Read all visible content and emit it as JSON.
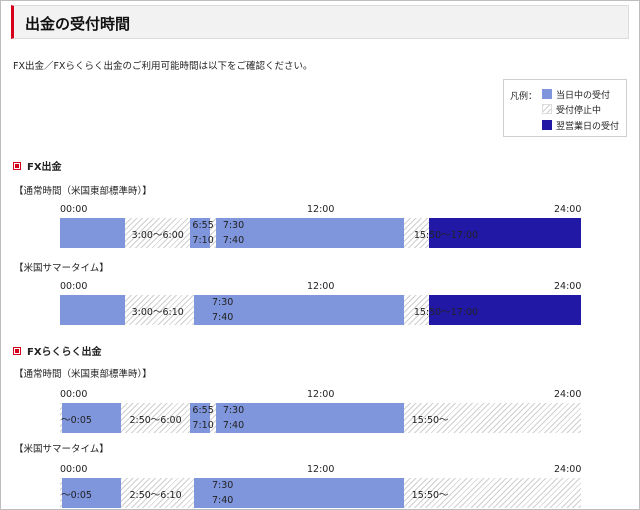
{
  "header": {
    "title": "出金の受付時間"
  },
  "intro": "FX出金／FXらくらく出金のご利用可能時間は以下をご確認ください。",
  "legend": {
    "title": "凡例：",
    "items": [
      {
        "label": "当日中の受付",
        "color": "#7f95dc",
        "kind": "accept"
      },
      {
        "label": "受付停止中",
        "color": "#cfcfcf",
        "kind": "stop"
      },
      {
        "label": "翌営業日の受付",
        "color": "#2218a6",
        "kind": "next"
      }
    ]
  },
  "axis": {
    "start": "00:00",
    "mid": "12:00",
    "end": "24:00"
  },
  "sections": [
    {
      "title": "FX出金",
      "timelines": [
        {
          "label": "【通常時間（米国東部標準時）】",
          "segments": [
            {
              "kind": "accept",
              "start": 0,
              "end": 3
            },
            {
              "kind": "stop",
              "start": 3,
              "end": 6
            },
            {
              "kind": "accept",
              "start": 6,
              "end": 6.917
            },
            {
              "kind": "stop",
              "start": 6.917,
              "end": 7.167
            },
            {
              "kind": "accept",
              "start": 7.167,
              "end": 7.5
            },
            {
              "kind": "accept",
              "start": 7.5,
              "end": 15.833
            },
            {
              "kind": "stop",
              "start": 15.833,
              "end": 17
            },
            {
              "kind": "next",
              "start": 17,
              "end": 24
            }
          ],
          "labels": [
            {
              "text": "3:00～6:00",
              "at": 3.3,
              "row": "mid"
            },
            {
              "text": "6:55",
              "at": 6.1,
              "row": "top"
            },
            {
              "text": "7:10",
              "at": 6.1,
              "row": "bottom"
            },
            {
              "text": "7:30",
              "at": 7.5,
              "row": "top"
            },
            {
              "text": "7:40",
              "at": 7.5,
              "row": "bottom"
            },
            {
              "text": "15:50～17:00",
              "at": 16.3,
              "row": "mid"
            }
          ]
        },
        {
          "label": "【米国サマータイム】",
          "segments": [
            {
              "kind": "accept",
              "start": 0,
              "end": 3
            },
            {
              "kind": "stop",
              "start": 3,
              "end": 6.167
            },
            {
              "kind": "accept",
              "start": 6.167,
              "end": 15.833
            },
            {
              "kind": "stop",
              "start": 15.833,
              "end": 17
            },
            {
              "kind": "next",
              "start": 17,
              "end": 24
            }
          ],
          "labels": [
            {
              "text": "3:00～6:10",
              "at": 3.3,
              "row": "mid"
            },
            {
              "text": "7:30",
              "at": 7,
              "row": "top"
            },
            {
              "text": "7:40",
              "at": 7,
              "row": "bottom"
            },
            {
              "text": "15:50～17:00",
              "at": 16.3,
              "row": "mid"
            }
          ]
        }
      ]
    },
    {
      "title": "FXらくらく出金",
      "timelines": [
        {
          "label": "【通常時間（米国東部標準時）】",
          "segments": [
            {
              "kind": "stop",
              "start": 0,
              "end": 0.083
            },
            {
              "kind": "accept",
              "start": 0.083,
              "end": 2.833
            },
            {
              "kind": "stop",
              "start": 2.833,
              "end": 6
            },
            {
              "kind": "accept",
              "start": 6,
              "end": 6.917
            },
            {
              "kind": "stop",
              "start": 6.917,
              "end": 7.167
            },
            {
              "kind": "accept",
              "start": 7.167,
              "end": 15.833
            },
            {
              "kind": "stop",
              "start": 15.833,
              "end": 24
            }
          ],
          "labels": [
            {
              "text": "～0:05",
              "at": 0.05,
              "row": "mid"
            },
            {
              "text": "2:50～6:00",
              "at": 3.2,
              "row": "mid"
            },
            {
              "text": "6:55",
              "at": 6.1,
              "row": "top"
            },
            {
              "text": "7:10",
              "at": 6.1,
              "row": "bottom"
            },
            {
              "text": "7:30",
              "at": 7.5,
              "row": "top"
            },
            {
              "text": "7:40",
              "at": 7.5,
              "row": "bottom"
            },
            {
              "text": "15:50～",
              "at": 16.2,
              "row": "mid"
            }
          ]
        },
        {
          "label": "【米国サマータイム】",
          "segments": [
            {
              "kind": "stop",
              "start": 0,
              "end": 0.083
            },
            {
              "kind": "accept",
              "start": 0.083,
              "end": 2.833
            },
            {
              "kind": "stop",
              "start": 2.833,
              "end": 6.167
            },
            {
              "kind": "accept",
              "start": 6.167,
              "end": 15.833
            },
            {
              "kind": "stop",
              "start": 15.833,
              "end": 24
            }
          ],
          "labels": [
            {
              "text": "～0:05",
              "at": 0.05,
              "row": "mid"
            },
            {
              "text": "2:50～6:10",
              "at": 3.2,
              "row": "mid"
            },
            {
              "text": "7:30",
              "at": 7,
              "row": "top"
            },
            {
              "text": "7:40",
              "at": 7,
              "row": "bottom"
            },
            {
              "text": "15:50～",
              "at": 16.2,
              "row": "mid"
            }
          ]
        }
      ]
    }
  ]
}
